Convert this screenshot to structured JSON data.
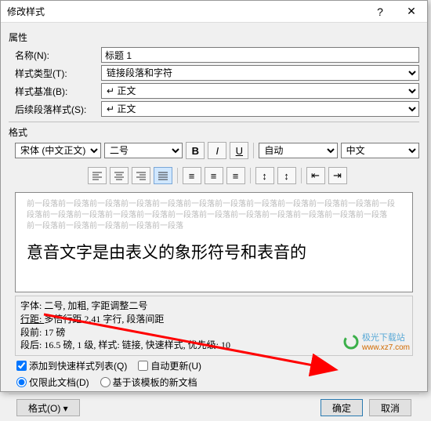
{
  "titlebar": {
    "title": "修改样式"
  },
  "properties": {
    "section": "属性",
    "name_label": "名称(N):",
    "name_value": "标题 1",
    "type_label": "样式类型(T):",
    "type_value": "链接段落和字符",
    "base_label": "样式基准(B):",
    "base_value": "↵ 正文",
    "follow_label": "后续段落样式(S):",
    "follow_value": "↵ 正文"
  },
  "format": {
    "section": "格式",
    "font_family": "宋体 (中文正文)",
    "font_size": "二号",
    "auto": "自动",
    "lang": "中文"
  },
  "preview": {
    "faded1": "前一段落前一段落前一段落前一段落前一段落前一段落前一段落前一段落前一段落前一段落前一段落前一段",
    "faded2": "段落前一段落前一段落前一段落前一段落前一段落前一段落前一段落前一段落前一段落前一段落前一段落",
    "faded3": "前一段落前一段落前一段落前一段落前一段落",
    "main": "意音文字是由表义的象形符号和表音的"
  },
  "desc": {
    "line1": "字体: 二号, 加粗, 字距调整二号",
    "line2a": "行距: ",
    "line2b": "多倍行距 2.41 字行, 段落间距",
    "line3": "段前: 17 磅",
    "line4": "段后: 16.5 磅, 1 级, 样式: 链接, 快速样式, 优先级: 10"
  },
  "checks": {
    "addlist": "添加到快速样式列表(Q)",
    "autoup": "自动更新(U)",
    "thisdoc": "仅限此文档(D)",
    "newdoc": "基于该模板的新文档"
  },
  "buttons": {
    "format_btn": "格式(O) ▾",
    "ok": "确定",
    "cancel": "取消"
  },
  "watermark": {
    "text": "极光下载站",
    "url": "www.xz7.com"
  }
}
